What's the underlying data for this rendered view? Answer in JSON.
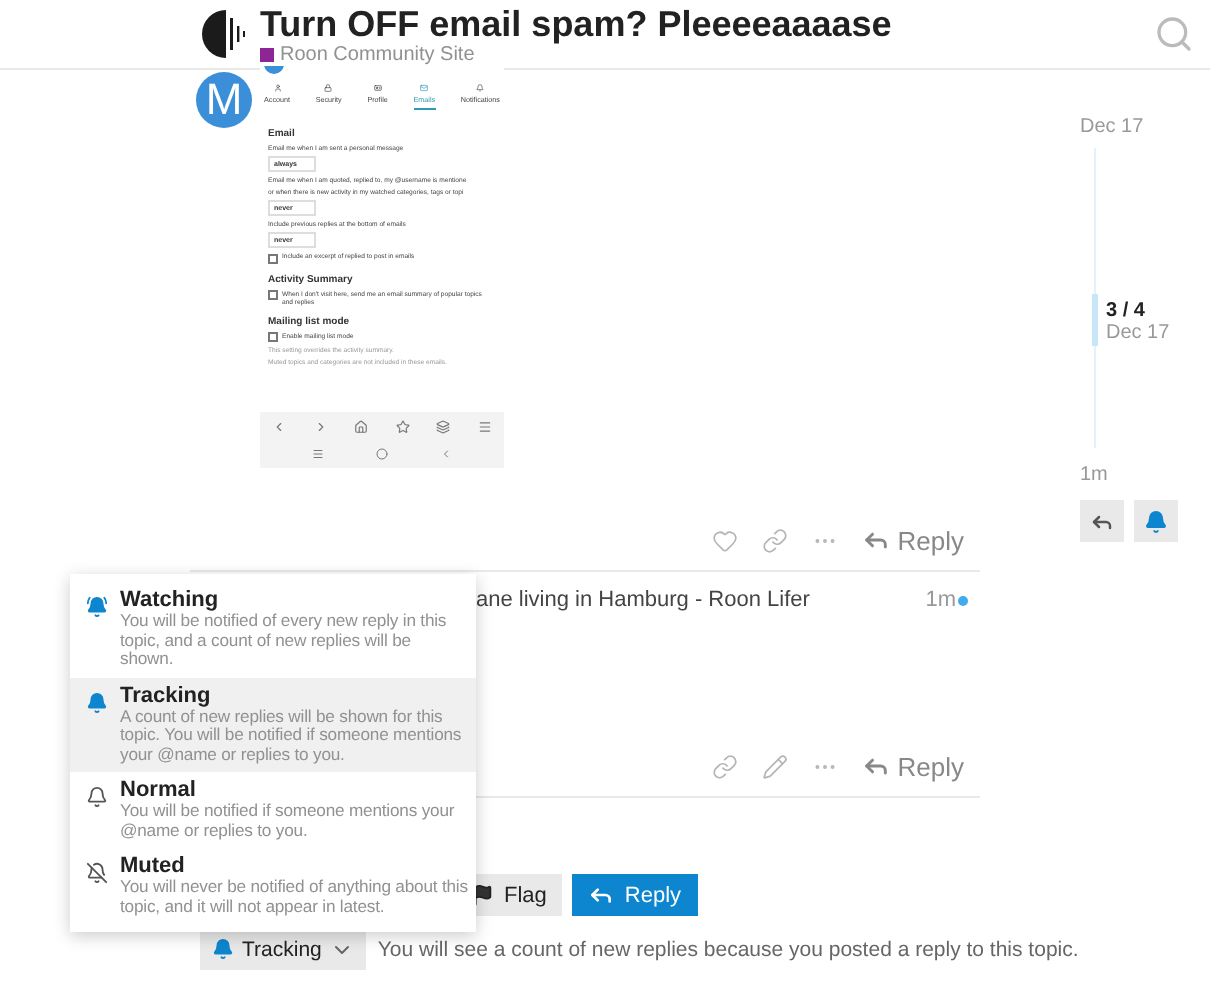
{
  "header": {
    "title": "Turn OFF email spam? Pleeeeaaaase",
    "category": {
      "name": "Roon Community Site",
      "color": "#8e2594"
    }
  },
  "posts": [
    {
      "kind": "screenshot",
      "avatar": "M",
      "shot": {
        "tabs": [
          {
            "label": "Account",
            "selected": false
          },
          {
            "label": "Security",
            "selected": false
          },
          {
            "label": "Profile",
            "selected": false
          },
          {
            "label": "Emails",
            "selected": true
          },
          {
            "label": "Notifications",
            "selected": false
          }
        ],
        "blocks": [
          {
            "kind": "heading",
            "text": "Email"
          },
          {
            "kind": "label",
            "text": "Email me when I am sent a personal message"
          },
          {
            "kind": "select",
            "text": "always"
          },
          {
            "kind": "label",
            "text": "Email me when I am quoted, replied to, my @username is mentione"
          },
          {
            "kind": "label",
            "text": "or when there is new activity in my watched categories, tags or topi"
          },
          {
            "kind": "select",
            "text": "never"
          },
          {
            "kind": "label",
            "text": "Include previous replies at the bottom of emails"
          },
          {
            "kind": "select",
            "text": "never"
          },
          {
            "kind": "checkbox",
            "text": "Include an excerpt of replied to post in emails",
            "checked": false
          },
          {
            "kind": "heading",
            "text": "Activity Summary"
          },
          {
            "kind": "checkbox",
            "text": "When I don't visit here, send me an email summary of popular topics and replies",
            "checked": false
          },
          {
            "kind": "heading",
            "text": "Mailing list mode"
          },
          {
            "kind": "checkbox",
            "text": "Enable mailing list mode",
            "checked": false
          },
          {
            "kind": "note",
            "text": "This setting overrides the activity summary."
          },
          {
            "kind": "note",
            "text": "Muted topics and categories are not included in these emails."
          }
        ]
      },
      "reply": "Reply"
    },
    {
      "kind": "text",
      "text": "ane living in Hamburg - Roon Lifer",
      "time": "1m",
      "unread": true,
      "reply": "Reply"
    }
  ],
  "footer_buttons": [
    {
      "kind": "flag",
      "label": "Flag"
    },
    {
      "kind": "reply",
      "label": "Reply"
    }
  ],
  "notifications": {
    "button": {
      "label": "Tracking",
      "kind": "tracking"
    },
    "reason": "You will see a count of new replies because you posted a reply to this topic.",
    "menu": [
      {
        "kind": "watching",
        "title": "Watching",
        "description": "You will be notified of every new reply in this topic, and a count of new replies will be shown.",
        "selected": false
      },
      {
        "kind": "tracking",
        "title": "Tracking",
        "description": "A count of new replies will be shown for this topic. You will be notified if someone mentions your @name or replies to you.",
        "selected": true
      },
      {
        "kind": "normal",
        "title": "Normal",
        "description": "You will be notified if someone mentions your @name or replies to you.",
        "selected": false
      },
      {
        "kind": "muted",
        "title": "Muted",
        "description": "You will never be notified of anything about this topic, and it will not appear in latest.",
        "selected": false
      }
    ]
  },
  "timeline": {
    "start": "Dec 17",
    "position": "3 / 4",
    "position_date": "Dec 17",
    "end": "1m"
  }
}
